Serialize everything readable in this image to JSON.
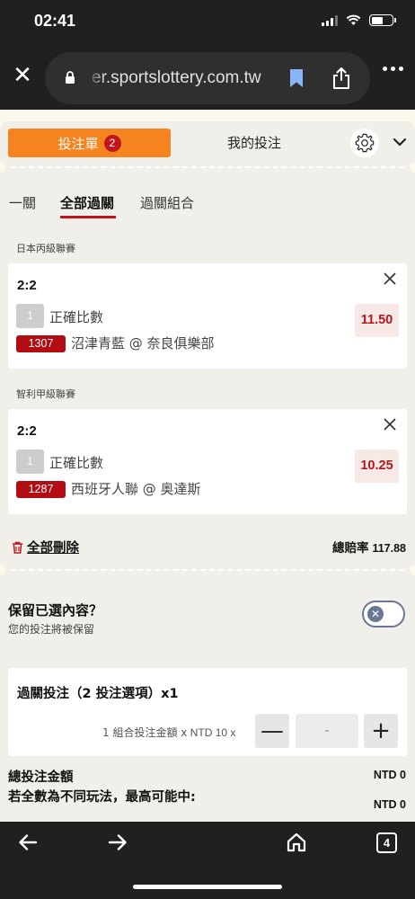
{
  "status_bar": {
    "time": "02:41",
    "battery_level": 0.55
  },
  "browser": {
    "url": "er.sportslottery.com.tw"
  },
  "header": {
    "tab_betslip": "投注單",
    "betslip_count": "2",
    "tab_mybets": "我的投注"
  },
  "subtabs": [
    "一關",
    "全部過關",
    "過關組合"
  ],
  "active_subtab": "全部過關",
  "selections": [
    {
      "league": "日本丙級聯賽",
      "score": "2:2",
      "num": "1",
      "market": "正確比數",
      "game_no": "1307",
      "teams": "沼津青藍 @ 奈良俱樂部",
      "odds": "11.50"
    },
    {
      "league": "智利甲級聯賽",
      "score": "2:2",
      "num": "1",
      "market": "正確比數",
      "game_no": "1287",
      "teams": "西班牙人聯 @ 奥達斯",
      "odds": "10.25"
    }
  ],
  "actions": {
    "delete_all": "全部刪除",
    "total_odds_label": "總賠率",
    "total_odds_value": "117.88"
  },
  "keep": {
    "title": "保留已選內容？",
    "subtitle": "您的投注將被保留",
    "toggle_on": false
  },
  "parlay": {
    "title": "過關投注（2 投注選項）x1",
    "stake_prefix": "1 組合投注金額 x",
    "stake_suffix": "NTD 10 x",
    "minus": "—",
    "plus": "+",
    "stake_value": "-"
  },
  "totals": {
    "total_stake_label": "總投注金額",
    "total_stake_value": "NTD 0",
    "max_win_label": "若全數為不同玩法，最高可能中:",
    "max_win_value": "NTD 0"
  },
  "bottom_nav": {
    "tab_count": "4"
  },
  "colors": {
    "accent_orange": "#f5831f",
    "brand_red": "#b30c12",
    "odds_red": "#b3161c"
  }
}
